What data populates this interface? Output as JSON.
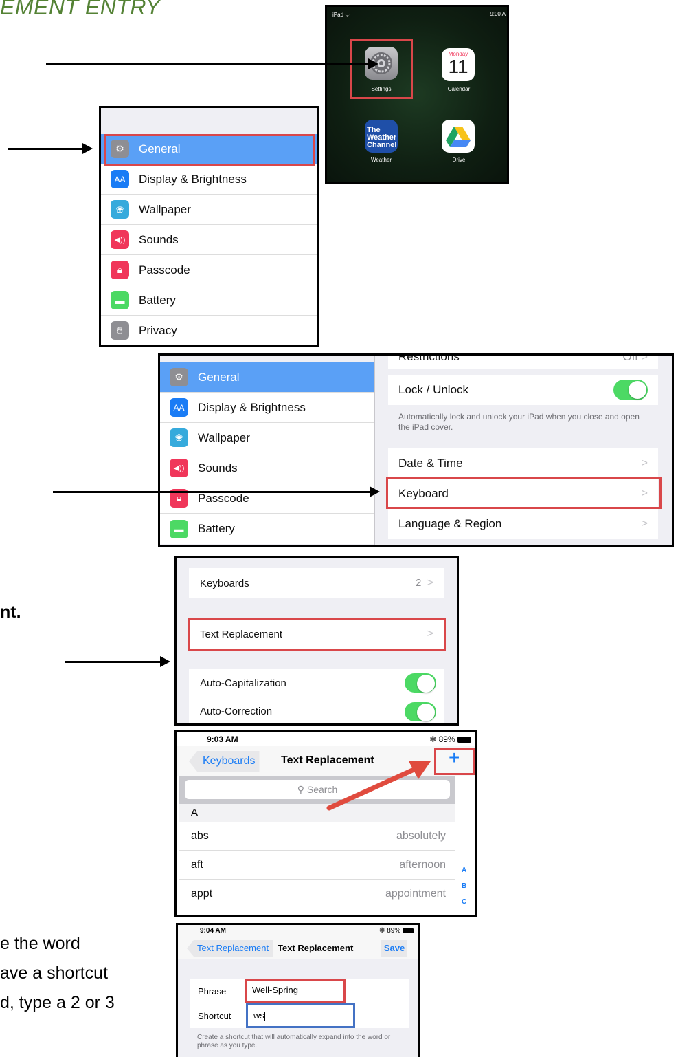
{
  "title": "EMENT ENTRY",
  "side_texts": {
    "t1": "nt.",
    "t2a": "e the word",
    "t2b": "ave a shortcut",
    "t2c": "d, type a 2 or 3"
  },
  "home": {
    "status_left": "iPad ᯤ",
    "status_right": "9:00 A",
    "apps": [
      {
        "label": "Settings",
        "icon": "settings-icon"
      },
      {
        "label": "Calendar",
        "icon": "calendar-icon",
        "day": "Monday",
        "date": "11"
      },
      {
        "label": "Weather",
        "icon": "weather-channel-icon",
        "text": "The Weather Channel"
      },
      {
        "label": "Drive",
        "icon": "drive-icon"
      }
    ]
  },
  "settings_list": [
    {
      "label": "General",
      "icon": "gear-icon",
      "color": "#8e8e93"
    },
    {
      "label": "Display & Brightness",
      "icon": "aa-icon",
      "color": "#1a7cf5"
    },
    {
      "label": "Wallpaper",
      "icon": "flower-icon",
      "color": "#36aadc"
    },
    {
      "label": "Sounds",
      "icon": "speaker-icon",
      "color": "#f0365a"
    },
    {
      "label": "Passcode",
      "icon": "lock-icon",
      "color": "#f0365a"
    },
    {
      "label": "Battery",
      "icon": "battery-icon",
      "color": "#4cd964"
    },
    {
      "label": "Privacy",
      "icon": "hand-icon",
      "color": "#8e8e93"
    }
  ],
  "general_detail": {
    "restrictions_label": "Restrictions",
    "restrictions_value": "Off",
    "lock_unlock_label": "Lock / Unlock",
    "lock_note": "Automatically lock and unlock your iPad when you close and open the iPad cover.",
    "date_time": "Date & Time",
    "keyboard": "Keyboard",
    "language_region": "Language & Region"
  },
  "keyboard_settings": {
    "keyboards_label": "Keyboards",
    "keyboards_value": "2",
    "text_replacement": "Text Replacement",
    "auto_cap": "Auto-Capitalization",
    "auto_correct": "Auto-Correction"
  },
  "text_replacement_list": {
    "time": "9:03 AM",
    "battery": "89%",
    "back": "Keyboards",
    "title": "Text Replacement",
    "add": "+",
    "search_placeholder": "Search",
    "section": "A",
    "rows": [
      {
        "shortcut": "abs",
        "phrase": "absolutely"
      },
      {
        "shortcut": "aft",
        "phrase": "afternoon"
      },
      {
        "shortcut": "appt",
        "phrase": "appointment"
      }
    ],
    "index": [
      "A",
      "B",
      "C"
    ]
  },
  "text_replacement_new": {
    "time": "9:04 AM",
    "battery": "89%",
    "back": "Text Replacement",
    "title": "Text Replacement",
    "save": "Save",
    "phrase_label": "Phrase",
    "phrase_value": "Well-Spring",
    "shortcut_label": "Shortcut",
    "shortcut_value": "ws",
    "note": "Create a shortcut that will automatically expand into the word or phrase as you type."
  },
  "colors": {
    "title_green": "#548235",
    "highlight_red": "#d9474a",
    "highlight_blue": "#4472c4",
    "ios_blue": "#1a7cf5",
    "ios_green": "#4cd964"
  }
}
